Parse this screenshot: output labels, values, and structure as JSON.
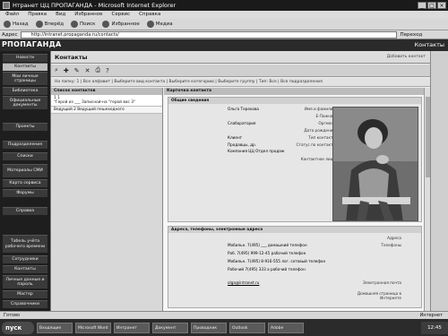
{
  "window": {
    "title": "Нтранет ЦЦ ПРОПАГАНДА - Microsoft Internet Explorer"
  },
  "menubar": [
    "Файл",
    "Правка",
    "Вид",
    "Избранное",
    "Сервис",
    "Справка"
  ],
  "toolbar": [
    "Назад",
    "Вперёд",
    "Поиск",
    "Избранное",
    "Медиа"
  ],
  "address": {
    "label": "Адрес",
    "value": "http://intranet.propaganda.ru/contacts/",
    "go": "Переход"
  },
  "app": {
    "logo": "РПОПАГАНДА",
    "page_title": "Контакты"
  },
  "sidebar": {
    "items": [
      {
        "label": "Новости"
      },
      {
        "label": "Контакты",
        "active": true
      },
      {
        "label": "Мои личные страницы"
      },
      {
        "label": "Библиотека"
      },
      {
        "label": "Официальные документы"
      },
      {
        "label": "Проекты"
      },
      {
        "label": "Подразделения"
      },
      {
        "label": "Списки"
      },
      {
        "label": "Материалы СМИ"
      },
      {
        "label": "Карта сервиса"
      },
      {
        "label": "Форумы"
      },
      {
        "label": "Справка"
      },
      {
        "label": "Табель учёта рабочего времени"
      },
      {
        "label": "Сотрудники"
      },
      {
        "label": "Контакты"
      },
      {
        "label": "Личные данные и пароль"
      },
      {
        "label": "Мастер"
      },
      {
        "label": "Справочники"
      }
    ]
  },
  "main": {
    "title": "Контакты",
    "title_right": "Добавить контакт",
    "filter": "На папку: 1  |  Все алфавит  |  Выберите вид контакта  |  Выберите категорию  |  Выберите группу  |  Тип: Все  |  Все подразделения",
    "list_header": "Список контактов",
    "list": [
      {
        "line1": "1 1",
        "line2": "\"Герой из ___ Записной-на \"герой вас 3\"",
        "selected": true
      },
      {
        "line1": "Ведущий 2 Ведущий пешеходного",
        "line2": ""
      }
    ],
    "card_header": "Карточка контакта",
    "personal_header": "Общие сведения",
    "fields": [
      {
        "label": "Имя и фамилия",
        "value": "Ольга Терехова"
      },
      {
        "label": "Е-Пажная",
        "value": ""
      },
      {
        "label": "Оргмест",
        "value": "Слаборатория"
      },
      {
        "label": "Дата рождения",
        "value": ""
      },
      {
        "label": "Тип контакта",
        "value": "Клиент"
      },
      {
        "label": "Статус по контакту",
        "value": "Продавцы, др."
      },
      {
        "label": "",
        "value": "Компания ЦЦ    Отдел продаж"
      },
      {
        "label": "Контактное лицо",
        "value": ""
      }
    ],
    "address_header": "Адреса, телефоны, электронные адреса",
    "addr_fields": [
      {
        "label": "Адреса",
        "value": ""
      },
      {
        "label": "Телефоны",
        "value": "Мобильн. 7(495)  ___ домашний телефон"
      },
      {
        "label": "",
        "value": "Раб.  7(495) 999-12-45  рабочий телефон"
      },
      {
        "label": "",
        "value": "Мобильн. 7(495) 8-916-555 лог. сотовый телефон"
      },
      {
        "label": "",
        "value": "Рабочий  7(495) 333 а   рабочий телефон"
      },
      {
        "label": "Электронная почта",
        "value": "olga@intranet.ru"
      },
      {
        "label": "Домашняя страница в Интернете",
        "value": ""
      }
    ]
  },
  "statusbar": {
    "left": "Готово",
    "right": "Интернет"
  },
  "taskbar": {
    "start": "пуск",
    "tasks": [
      "Входящие",
      "Microsoft Word",
      "Интранет",
      "Документ",
      "Проводник",
      "Outlook",
      "Adobe"
    ],
    "clock": "12:45"
  }
}
